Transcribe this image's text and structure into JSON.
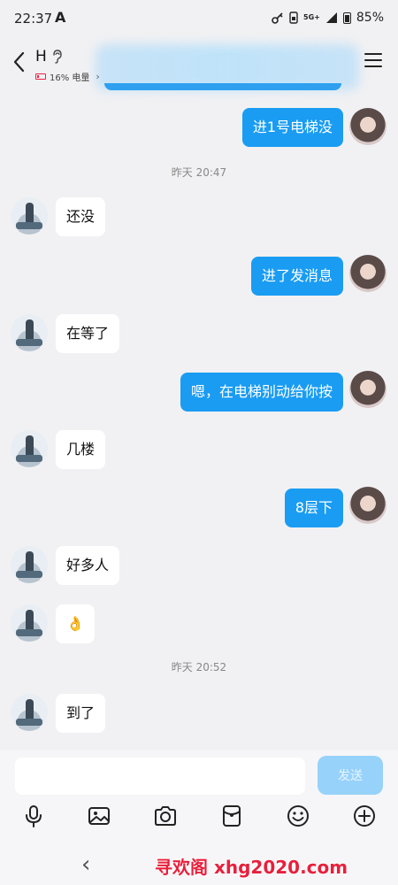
{
  "status_bar": {
    "time": "22:37",
    "app_letter": "A",
    "network": "5G+",
    "battery": "85%"
  },
  "header": {
    "contact_name": "H",
    "device_battery": "16% 电量",
    "accent_color": "#1a9cf3"
  },
  "messages": [
    {
      "from": "me",
      "text": "进1号电梯没"
    },
    {
      "type": "time",
      "text": "昨天 20:47"
    },
    {
      "from": "them",
      "text": "还没"
    },
    {
      "from": "me",
      "text": "进了发消息"
    },
    {
      "from": "them",
      "text": "在等了"
    },
    {
      "from": "me",
      "text": "嗯，在电梯别动给你按"
    },
    {
      "from": "them",
      "text": "几楼"
    },
    {
      "from": "me",
      "text": "8层下"
    },
    {
      "from": "them",
      "text": "好多人"
    },
    {
      "from": "them",
      "text": "👌"
    },
    {
      "type": "time",
      "text": "昨天 20:52"
    },
    {
      "from": "them",
      "text": "到了"
    }
  ],
  "input": {
    "value": "",
    "placeholder": "",
    "send_label": "发送"
  },
  "toolbar_icons": [
    "microphone-icon",
    "image-icon",
    "camera-icon",
    "red-packet-icon",
    "emoji-icon",
    "plus-icon"
  ],
  "watermark": "寻欢阁 xhg2020.com"
}
